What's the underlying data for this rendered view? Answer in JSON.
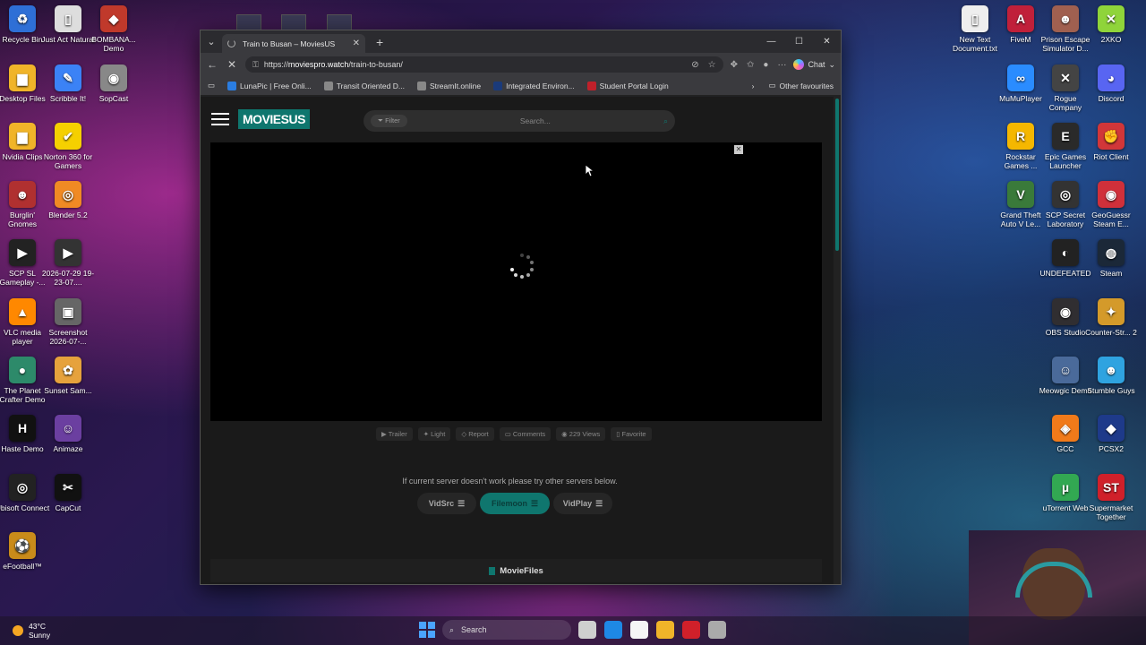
{
  "desktop": {
    "left_icons": [
      {
        "label": "Recycle Bin",
        "glyph": "♻",
        "color": "#2e6fd6"
      },
      {
        "label": "Just Act Natural",
        "glyph": "▯",
        "color": "#dddddd"
      },
      {
        "label": "BOMBANA... Demo",
        "glyph": "◆",
        "color": "#c0392b"
      },
      {
        "label": "Desktop Files",
        "glyph": "▆",
        "color": "#f0b429"
      },
      {
        "label": "Scribble It!",
        "glyph": "✎",
        "color": "#3b82f6"
      },
      {
        "label": "SopCast",
        "glyph": "◉",
        "color": "#888888"
      },
      {
        "label": "Nvidia Clips",
        "glyph": "▆",
        "color": "#f0b429"
      },
      {
        "label": "Norton 360 for Gamers",
        "glyph": "✔",
        "color": "#f5d000"
      },
      {
        "label": "Burglin' Gnomes",
        "glyph": "☻",
        "color": "#b03030"
      },
      {
        "label": "Blender 5.2",
        "glyph": "◎",
        "color": "#f08a24"
      },
      {
        "label": "SCP SL Gameplay -...",
        "glyph": "▶",
        "color": "#222222"
      },
      {
        "label": "2026-07-29 19-23-07....",
        "glyph": "▶",
        "color": "#333333"
      },
      {
        "label": "VLC media player",
        "glyph": "▲",
        "color": "#ff8800"
      },
      {
        "label": "Screenshot 2026-07-...",
        "glyph": "▣",
        "color": "#666666"
      },
      {
        "label": "The Planet Crafter Demo",
        "glyph": "●",
        "color": "#2d8a6a"
      },
      {
        "label": "Sunset Sam...",
        "glyph": "✿",
        "color": "#e6a23c"
      },
      {
        "label": "Haste Demo",
        "glyph": "H",
        "color": "#111111"
      },
      {
        "label": "Animaze",
        "glyph": "☺",
        "color": "#6b3fa0"
      },
      {
        "label": "Ubisoft Connect",
        "glyph": "◎",
        "color": "#222222"
      },
      {
        "label": "CapCut",
        "glyph": "✂",
        "color": "#111111"
      },
      {
        "label": "eFootball™",
        "glyph": "⚽",
        "color": "#c98b1a"
      }
    ],
    "right_icons": [
      {
        "label": "New Text Document.txt",
        "glyph": "▯",
        "color": "#eeeeee"
      },
      {
        "label": "FiveM",
        "glyph": "A",
        "color": "#c0203a"
      },
      {
        "label": "Prison Escape Simulator D...",
        "glyph": "☻",
        "color": "#a06050"
      },
      {
        "label": "2XKO",
        "glyph": "✕",
        "color": "#8fd43a"
      },
      {
        "label": "MuMuPlayer",
        "glyph": "∞",
        "color": "#2a8cff"
      },
      {
        "label": "Rogue Company",
        "glyph": "✕",
        "color": "#444444"
      },
      {
        "label": "Discord",
        "glyph": "◕",
        "color": "#5865f2"
      },
      {
        "label": "Rockstar Games ...",
        "glyph": "R",
        "color": "#f5b700"
      },
      {
        "label": "Epic Games Launcher",
        "glyph": "E",
        "color": "#2a2a2a"
      },
      {
        "label": "Riot Client",
        "glyph": "✊",
        "color": "#d13639"
      },
      {
        "label": "Grand Theft Auto V Le...",
        "glyph": "V",
        "color": "#3a7a3a"
      },
      {
        "label": "SCP Secret Laboratory",
        "glyph": "◎",
        "color": "#333333"
      },
      {
        "label": "GeoGuessr Steam E...",
        "glyph": "◉",
        "color": "#d0303a"
      },
      {
        "label": "UNDEFEATED",
        "glyph": "◐",
        "color": "#222222"
      },
      {
        "label": "Steam",
        "glyph": "◍",
        "color": "#1b2838"
      },
      {
        "label": "OBS Studio",
        "glyph": "◉",
        "color": "#302e31"
      },
      {
        "label": "Counter-Str... 2",
        "glyph": "✦",
        "color": "#d49a2a"
      },
      {
        "label": "Meowgic Demo",
        "glyph": "☺",
        "color": "#4a6a9a"
      },
      {
        "label": "Stumble Guys",
        "glyph": "☻",
        "color": "#2fa3e0"
      },
      {
        "label": "GCC",
        "glyph": "◈",
        "color": "#f07a1a"
      },
      {
        "label": "PCSX2",
        "glyph": "◆",
        "color": "#1e3a8a"
      },
      {
        "label": "uTorrent Web",
        "glyph": "µ",
        "color": "#32a852"
      },
      {
        "label": "Supermarket Together",
        "glyph": "ST",
        "color": "#d0202a"
      }
    ]
  },
  "browser": {
    "tab_title": "Train to Busan – MoviesUS",
    "url_prefix": "https://",
    "url_host": "moviespro.watch",
    "url_path": "/train-to-busan/",
    "chat_label": "Chat",
    "favourites": [
      {
        "label": "LunaPic | Free Onli...",
        "color": "#2a7de1"
      },
      {
        "label": "Transit Oriented D...",
        "color": "#888888"
      },
      {
        "label": "StreamIt.online",
        "color": "#888888"
      },
      {
        "label": "Integrated Environ...",
        "color": "#1a3a7a"
      },
      {
        "label": "Student Portal Login",
        "color": "#c0202a"
      }
    ],
    "other_favourites": "Other favourites"
  },
  "site": {
    "logo": "MOVIESUS",
    "filter_label": "Filter",
    "search_placeholder": "Search...",
    "actions": [
      {
        "icon": "▶",
        "label": "Trailer"
      },
      {
        "icon": "✦",
        "label": "Light"
      },
      {
        "icon": "◇",
        "label": "Report"
      },
      {
        "icon": "▭",
        "label": "Comments"
      },
      {
        "icon": "◉",
        "label": "229 Views"
      },
      {
        "icon": "▯",
        "label": "Favorite"
      }
    ],
    "server_message": "If current server doesn't work please try other servers below.",
    "servers": [
      {
        "label": "VidSrc",
        "active": false
      },
      {
        "label": "Filemoon",
        "active": true
      },
      {
        "label": "VidPlay",
        "active": false
      }
    ],
    "movie_files": "MovieFiles"
  },
  "taskbar": {
    "temperature": "43°C",
    "condition": "Sunny",
    "search_label": "Search",
    "apps": [
      {
        "name": "task-view",
        "color": "#cfcfcf"
      },
      {
        "name": "edge",
        "color": "#1e88e5"
      },
      {
        "name": "store",
        "color": "#f5f5f5"
      },
      {
        "name": "file-explorer",
        "color": "#f0b429"
      },
      {
        "name": "recorder",
        "color": "#d0202a"
      },
      {
        "name": "settings",
        "color": "#aaaaaa"
      }
    ]
  }
}
